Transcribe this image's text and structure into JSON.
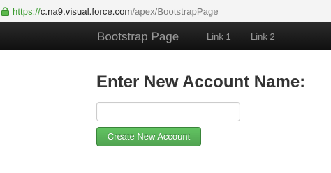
{
  "browser": {
    "url_scheme": "https://",
    "url_host": "c.na9.visual.force.com",
    "url_path": "/apex/BootstrapPage",
    "lock_icon": "lock-icon",
    "secure_color": "#3a9b2f"
  },
  "navbar": {
    "brand": "Bootstrap Page",
    "links": [
      {
        "label": "Link 1"
      },
      {
        "label": "Link 2"
      }
    ],
    "background": "#1b1b1b",
    "text_color": "#9a9a9a"
  },
  "form": {
    "heading": "Enter New Account Name:",
    "name_input": {
      "value": "",
      "placeholder": ""
    },
    "submit_label": "Create New Account",
    "submit_color": "#5bb75b"
  }
}
